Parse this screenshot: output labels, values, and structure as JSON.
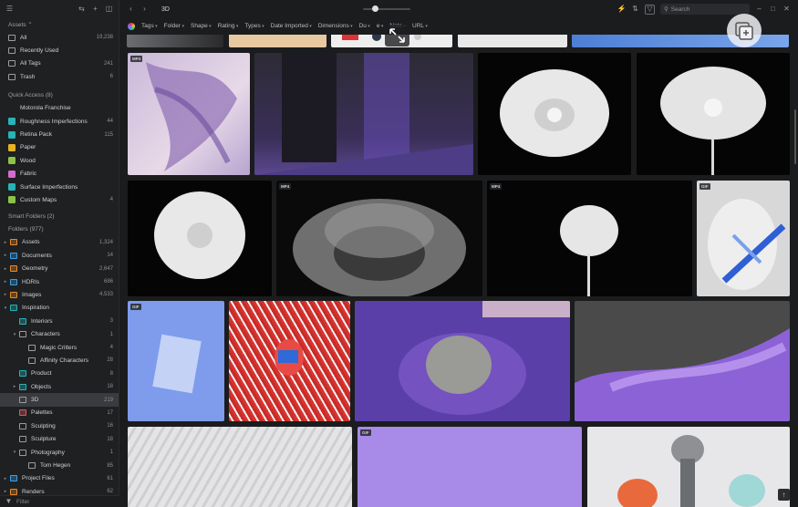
{
  "sidebar": {
    "header": "Assets ⌃",
    "system": [
      {
        "label": "All",
        "count": "19,238",
        "icon": "grid-icon"
      },
      {
        "label": "Recently Used",
        "count": "",
        "icon": "clock-icon"
      },
      {
        "label": "All Tags",
        "count": "241",
        "icon": "tag-icon"
      },
      {
        "label": "Trash",
        "count": "6",
        "icon": "trash-icon"
      }
    ],
    "quick_access_title": "Quick Access (8)",
    "quick_access": [
      {
        "label": "Motorola Franchise",
        "count": "",
        "color": ""
      },
      {
        "label": "Roughness Imperfections",
        "count": "44",
        "color": "#27b3b8"
      },
      {
        "label": "Retina Pack",
        "count": "115",
        "color": "#27b3b8"
      },
      {
        "label": "Paper",
        "count": "",
        "color": "#e6b324"
      },
      {
        "label": "Wood",
        "count": "",
        "color": "#8bc34a"
      },
      {
        "label": "Fabric",
        "count": "",
        "color": "#d66ad0"
      },
      {
        "label": "Surface Imperfections",
        "count": "",
        "color": "#27b3b8"
      },
      {
        "label": "Custom Maps",
        "count": "4",
        "color": "#8bc34a"
      }
    ],
    "smart_folders_title": "Smart Folders (2)",
    "folders_title": "Folders (977)",
    "folders": [
      {
        "label": "Assets",
        "count": "1,324",
        "color": "#e88a2c",
        "indent": 0,
        "tri": "▸"
      },
      {
        "label": "Documents",
        "count": "14",
        "color": "#3aa0e8",
        "indent": 0,
        "tri": "▸"
      },
      {
        "label": "Geometry",
        "count": "2,647",
        "color": "#e88a2c",
        "indent": 0,
        "tri": "▸"
      },
      {
        "label": "HDRIs",
        "count": "686",
        "color": "#3aa0e8",
        "indent": 0,
        "tri": "▸"
      },
      {
        "label": "Images",
        "count": "4,533",
        "color": "#e88a2c",
        "indent": 0,
        "tri": "▸"
      },
      {
        "label": "Inspiration",
        "count": "",
        "color": "#27b3b8",
        "indent": 0,
        "tri": "▾"
      },
      {
        "label": "Interiors",
        "count": "3",
        "color": "#27b3b8",
        "indent": 1,
        "tri": ""
      },
      {
        "label": "Characters",
        "count": "1",
        "color": "",
        "indent": 1,
        "tri": "▾"
      },
      {
        "label": "Magic Critters",
        "count": "4",
        "color": "",
        "indent": 2,
        "tri": ""
      },
      {
        "label": "Affinity Characters",
        "count": "28",
        "color": "",
        "indent": 2,
        "tri": ""
      },
      {
        "label": "Product",
        "count": "8",
        "color": "#27b3b8",
        "indent": 1,
        "tri": ""
      },
      {
        "label": "Objects",
        "count": "18",
        "color": "#27b3b8",
        "indent": 1,
        "tri": "▸"
      },
      {
        "label": "3D",
        "count": "219",
        "color": "",
        "indent": 1,
        "tri": "",
        "selected": true
      },
      {
        "label": "Palettes",
        "count": "17",
        "color": "#e0565a",
        "indent": 1,
        "tri": ""
      },
      {
        "label": "Sculpting",
        "count": "16",
        "color": "",
        "indent": 1,
        "tri": ""
      },
      {
        "label": "Sculpture",
        "count": "18",
        "color": "",
        "indent": 1,
        "tri": ""
      },
      {
        "label": "Photography",
        "count": "1",
        "color": "",
        "indent": 1,
        "tri": "▾"
      },
      {
        "label": "Tom Hegen",
        "count": "85",
        "color": "",
        "indent": 2,
        "tri": ""
      },
      {
        "label": "Project Files",
        "count": "61",
        "color": "#3aa0e8",
        "indent": 0,
        "tri": "▸"
      },
      {
        "label": "Renders",
        "count": "62",
        "color": "#e88a2c",
        "indent": 0,
        "tri": "▸"
      }
    ],
    "filter_placeholder": "Filter"
  },
  "topbar": {
    "breadcrumb": "3D",
    "search_placeholder": "Search"
  },
  "filterbar": [
    "Tags",
    "Folder",
    "Shape",
    "Rating",
    "Types",
    "Date Imported",
    "Dimensions",
    "Du",
    "e",
    "Note",
    "URL"
  ],
  "badges": {
    "mp4": "MP4",
    "gif": "GIF"
  },
  "icons": [
    "menu-icon",
    "sort-icon",
    "plus-icon",
    "panel-icon",
    "back-arrow-icon",
    "forward-arrow-icon",
    "lightning-icon",
    "sort-order-icon",
    "filter-icon",
    "search-icon",
    "minimize-icon",
    "maximize-icon",
    "close-icon",
    "expand-icon",
    "copy-add-icon",
    "scroll-top-icon"
  ]
}
